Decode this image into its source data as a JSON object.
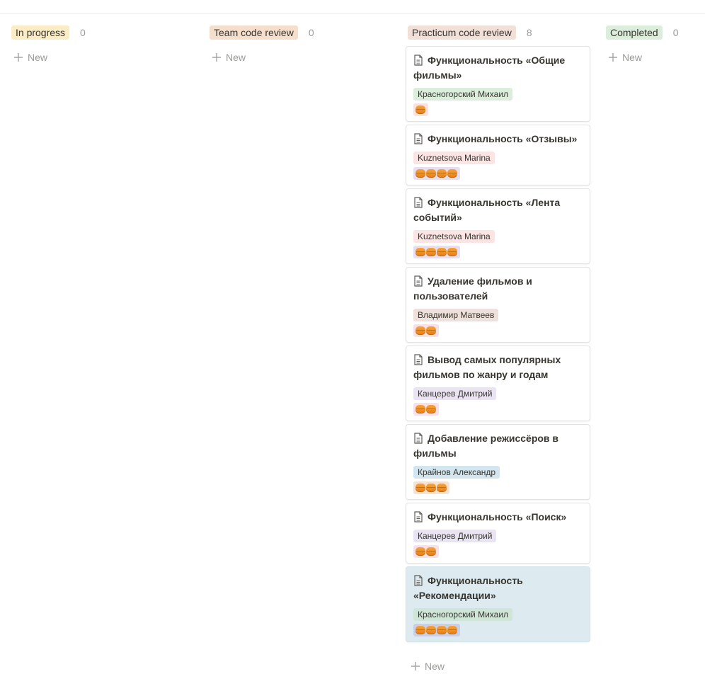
{
  "board": {
    "columns": [
      {
        "name": "In progress",
        "count": "0",
        "color": "#fbecc6",
        "new_label": "New"
      },
      {
        "name": "Team code review",
        "count": "0",
        "color": "#f5dfcc",
        "new_label": "New"
      },
      {
        "name": "Practicum code review",
        "count": "8",
        "color": "#f1e0d8",
        "new_label": "New"
      },
      {
        "name": "Completed",
        "count": "0",
        "color": "#dbeddb",
        "new_label": "New"
      }
    ],
    "cards": [
      {
        "title": "Функциональность «Общие фильмы»",
        "assignee": "Красногорский Михаил",
        "assignee_color": "#dbeddb",
        "effort": 1,
        "effort_bg": "#fbe2dd"
      },
      {
        "title": "Функциональность  «Отзывы»",
        "assignee": "Kuznetsova Marina",
        "assignee_color": "#fbe4e4",
        "effort": 4,
        "effort_bg": "#e8def1"
      },
      {
        "title": "Функциональность «Лента событий»",
        "assignee": "Kuznetsova Marina",
        "assignee_color": "#fbe4e4",
        "effort": 4,
        "effort_bg": "#e8def1"
      },
      {
        "title": "Удаление фильмов и пользователей",
        "assignee": "Владимир Матвеев",
        "assignee_color": "#eee0da",
        "effort": 2,
        "effort_bg": "#f9e0e6"
      },
      {
        "title": "Вывод самых популярных фильмов по жанру и годам",
        "assignee": "Канцерев Дмитрий",
        "assignee_color": "#eae4f2",
        "effort": 2,
        "effort_bg": "#f9e0e6"
      },
      {
        "title": "Добавление режиссёров в фильмы",
        "assignee": "Крайнов Александр",
        "assignee_color": "#d3e5ef",
        "effort": 3,
        "effort_bg": "#f6e2d3"
      },
      {
        "title": "Функциональность «Поиск»",
        "assignee": "Канцерев Дмитрий",
        "assignee_color": "#eae4f2",
        "effort": 2,
        "effort_bg": "#f9e0e6"
      },
      {
        "title": "Функциональность «Рекомендации»",
        "assignee": "Красногорский Михаил",
        "assignee_color": "#cfe5d8",
        "effort": 4,
        "effort_bg": "#c9cfe6",
        "selected": true
      }
    ],
    "new_under_cards": "New"
  },
  "icons": {
    "new": "plus-icon",
    "card": "page-icon",
    "effort": "orange-chip-icon"
  }
}
